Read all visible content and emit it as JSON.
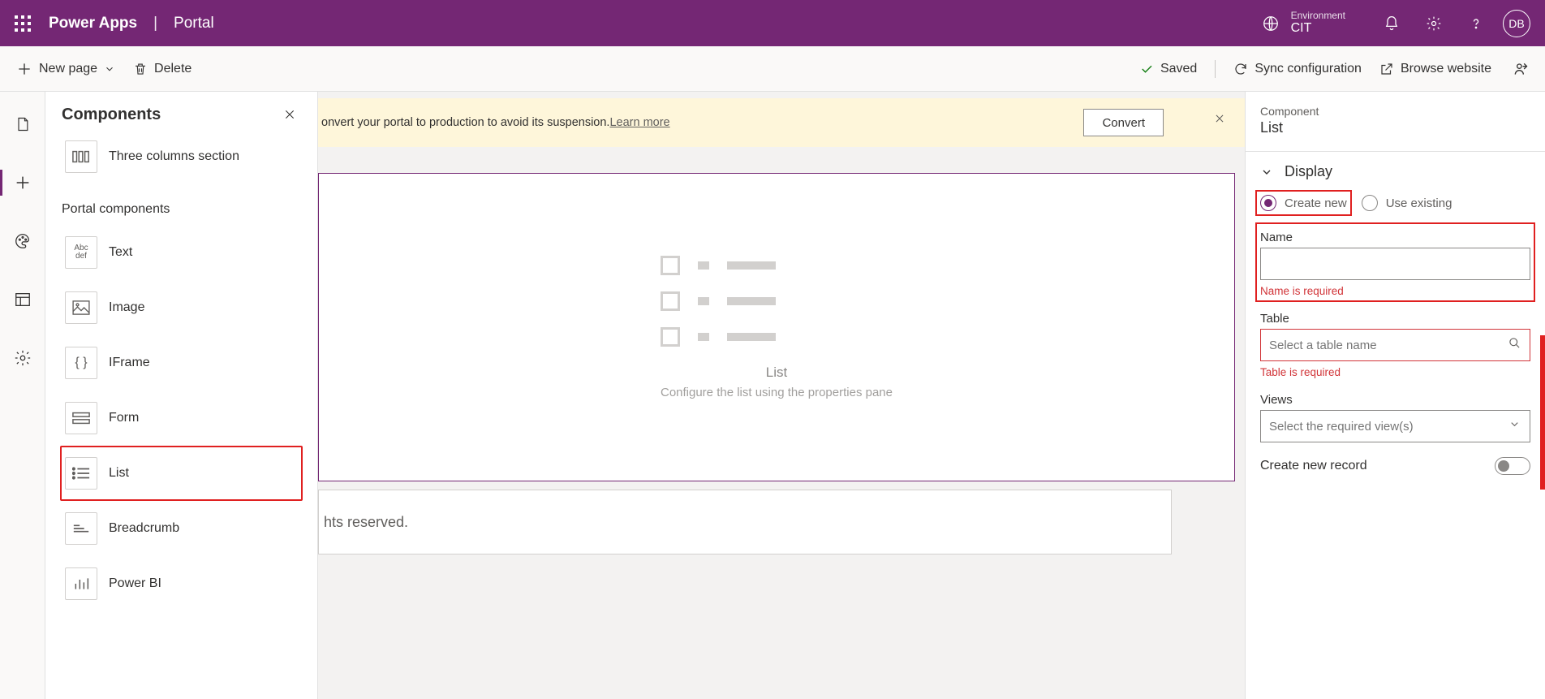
{
  "header": {
    "app": "Power Apps",
    "subtitle": "Portal",
    "environment_label": "Environment",
    "environment_name": "CIT",
    "avatar_initials": "DB"
  },
  "cmdbar": {
    "new_page": "New page",
    "delete": "Delete",
    "saved": "Saved",
    "sync": "Sync configuration",
    "browse": "Browse website"
  },
  "components_panel": {
    "title": "Components",
    "items_top": [
      {
        "label": "Three columns section"
      }
    ],
    "section_label": "Portal components",
    "items": [
      {
        "label": "Text"
      },
      {
        "label": "Image"
      },
      {
        "label": "IFrame"
      },
      {
        "label": "Form"
      },
      {
        "label": "List",
        "highlighted": true
      },
      {
        "label": "Breadcrumb"
      },
      {
        "label": "Power BI"
      }
    ]
  },
  "banner": {
    "text_prefix": "onvert your portal to production to avoid its suspension. ",
    "learn_more": "Learn more",
    "convert": "Convert"
  },
  "canvas": {
    "list_title": "List",
    "list_subtitle": "Configure the list using the properties pane",
    "footer_text": "hts reserved."
  },
  "props": {
    "component_label": "Component",
    "component_name": "List",
    "display_header": "Display",
    "create_new": "Create new",
    "use_existing": "Use existing",
    "name_label": "Name",
    "name_error": "Name is required",
    "table_label": "Table",
    "table_placeholder": "Select a table name",
    "table_error": "Table is required",
    "views_label": "Views",
    "views_placeholder": "Select the required view(s)",
    "create_record": "Create new record"
  }
}
